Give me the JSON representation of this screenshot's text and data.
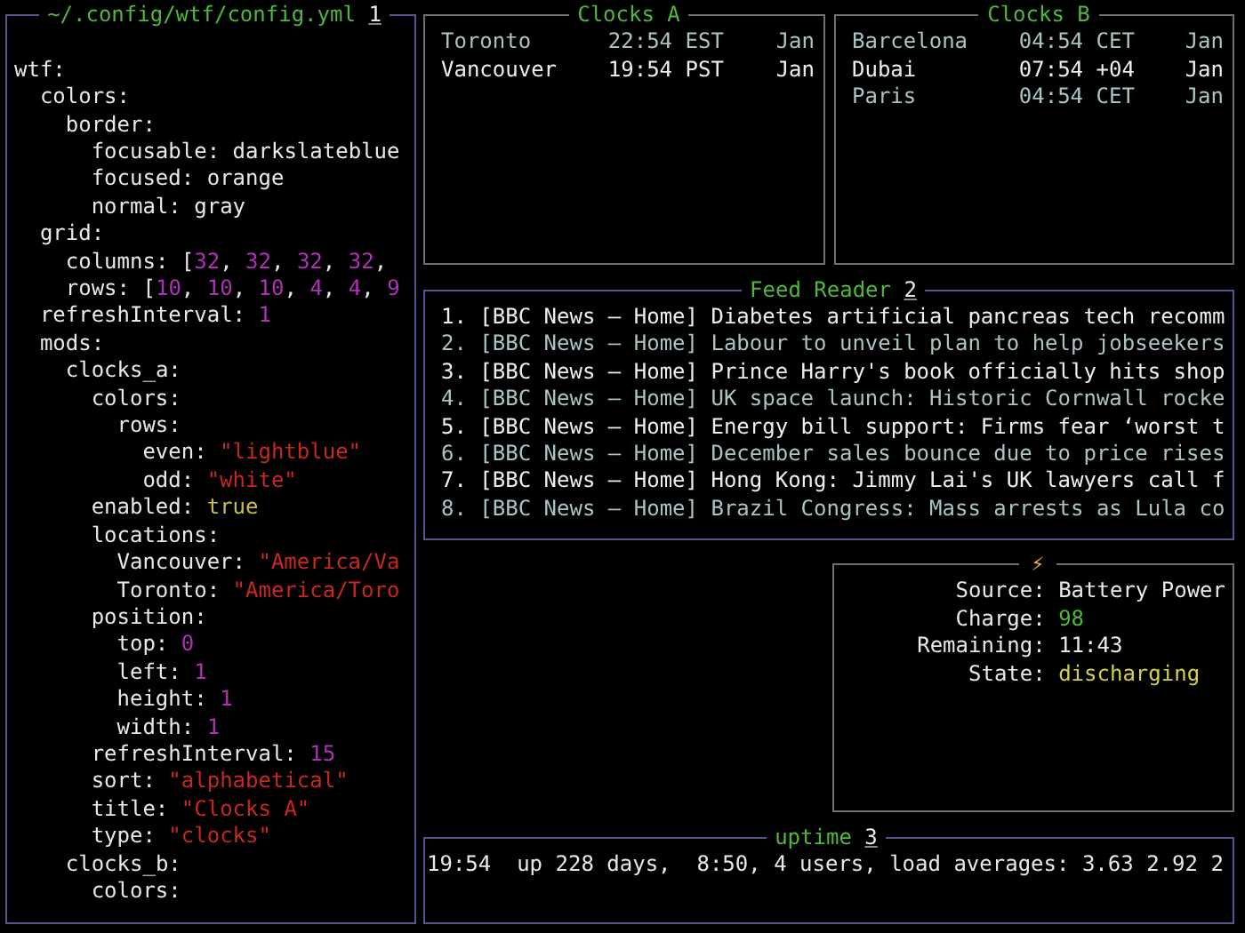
{
  "config_panel": {
    "title": "~/.config/wtf/config.yml",
    "hotkey": "1",
    "lines": [
      {
        "key": "wtf:",
        "children": [
          {
            "key": "colors:",
            "children": [
              {
                "key": "border:",
                "children": [
                  {
                    "key": "focusable:",
                    "value": "darkslateblue",
                    "kind": "plain"
                  },
                  {
                    "key": "focused:",
                    "value": "orange",
                    "kind": "plain"
                  },
                  {
                    "key": "normal:",
                    "value": "gray",
                    "kind": "plain"
                  }
                ]
              }
            ]
          },
          {
            "key": "grid:",
            "children": [
              {
                "key": "columns:",
                "value": "[32, 32, 32, 32,",
                "kind": "list"
              },
              {
                "key": "rows:",
                "value": "[10, 10, 10, 4, 4, 9",
                "kind": "list"
              }
            ]
          },
          {
            "key": "refreshInterval:",
            "value": "1",
            "kind": "number"
          },
          {
            "key": "mods:",
            "children": [
              {
                "key": "clocks_a:",
                "children": [
                  {
                    "key": "colors:",
                    "children": [
                      {
                        "key": "rows:",
                        "children": [
                          {
                            "key": "even:",
                            "value": "\"lightblue\"",
                            "kind": "string"
                          },
                          {
                            "key": "odd:",
                            "value": "\"white\"",
                            "kind": "string"
                          }
                        ]
                      }
                    ]
                  },
                  {
                    "key": "enabled:",
                    "value": "true",
                    "kind": "bool"
                  },
                  {
                    "key": "locations:",
                    "children": [
                      {
                        "key": "Vancouver:",
                        "value": "\"America/Va",
                        "kind": "string"
                      },
                      {
                        "key": "Toronto:",
                        "value": "\"America/Toro",
                        "kind": "string"
                      }
                    ]
                  },
                  {
                    "key": "position:",
                    "children": [
                      {
                        "key": "top:",
                        "value": "0",
                        "kind": "number"
                      },
                      {
                        "key": "left:",
                        "value": "1",
                        "kind": "number"
                      },
                      {
                        "key": "height:",
                        "value": "1",
                        "kind": "number"
                      },
                      {
                        "key": "width:",
                        "value": "1",
                        "kind": "number"
                      }
                    ]
                  },
                  {
                    "key": "refreshInterval:",
                    "value": "15",
                    "kind": "number"
                  },
                  {
                    "key": "sort:",
                    "value": "\"alphabetical\"",
                    "kind": "string"
                  },
                  {
                    "key": "title:",
                    "value": "\"Clocks A\"",
                    "kind": "string"
                  },
                  {
                    "key": "type:",
                    "value": "\"clocks\"",
                    "kind": "string"
                  }
                ]
              },
              {
                "key": "clocks_b:",
                "children": [
                  {
                    "key": "colors:"
                  }
                ]
              }
            ]
          }
        ]
      }
    ]
  },
  "clocks": [
    {
      "title": "Clocks A",
      "rows": [
        {
          "city": "Toronto",
          "time": "22:54 EST",
          "date": "Jan"
        },
        {
          "city": "Vancouver",
          "time": "19:54 PST",
          "date": "Jan"
        }
      ]
    },
    {
      "title": "Clocks B",
      "rows": [
        {
          "city": "Barcelona",
          "time": "04:54 CET",
          "date": "Jan"
        },
        {
          "city": "Dubai",
          "time": "07:54 +04",
          "date": "Jan"
        },
        {
          "city": "Paris",
          "time": "04:54 CET",
          "date": "Jan"
        }
      ]
    }
  ],
  "feed_reader": {
    "title": "Feed Reader",
    "hotkey": "2",
    "items": [
      {
        "number": "1.",
        "source": "[BBC News – Home]",
        "headline": "Diabetes artificial pancreas tech recomm"
      },
      {
        "number": "2.",
        "source": "[BBC News – Home]",
        "headline": "Labour to unveil plan to help jobseekers"
      },
      {
        "number": "3.",
        "source": "[BBC News – Home]",
        "headline": "Prince Harry's book officially hits shop"
      },
      {
        "number": "4.",
        "source": "[BBC News – Home]",
        "headline": "UK space launch: Historic Cornwall rocke"
      },
      {
        "number": "5.",
        "source": "[BBC News – Home]",
        "headline": "Energy bill support: Firms fear ‘worst t"
      },
      {
        "number": "6.",
        "source": "[BBC News – Home]",
        "headline": "December sales bounce due to price rises"
      },
      {
        "number": "7.",
        "source": "[BBC News – Home]",
        "headline": "Hong Kong: Jimmy Lai's UK lawyers call f"
      },
      {
        "number": "8.",
        "source": "[BBC News – Home]",
        "headline": "Brazil Congress: Mass arrests as Lula co"
      }
    ]
  },
  "battery": {
    "title": "⚡",
    "rows": [
      {
        "label": "Source:",
        "value": "Battery Power",
        "color": "#e8e8e8"
      },
      {
        "label": "Charge:",
        "value": "98",
        "color": "#4fb83a"
      },
      {
        "label": "Remaining:",
        "value": "11:43",
        "color": "#e8e8e8"
      },
      {
        "label": "State:",
        "value": "discharging",
        "color": "#d4d04a"
      }
    ]
  },
  "uptime": {
    "title": "uptime",
    "hotkey": "3",
    "text": "19:54  up 228 days,  8:50, 4 users, load averages: 3.63 2.92 2"
  }
}
